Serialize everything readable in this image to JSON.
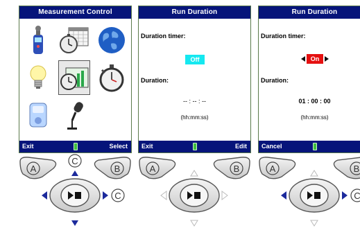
{
  "colors": {
    "title_bar": "#06147a",
    "off_toggle": "#15e8f0",
    "on_toggle": "#e51010",
    "battery": "#3fbf3f",
    "key_arrow_active": "#1c2a9c"
  },
  "panel1": {
    "title": "Measurement Control",
    "icons": [
      "sound-level-meter-icon",
      "calendar-timer-icon",
      "globe-icon",
      "light-bulb-icon",
      "run-duration-icon",
      "stopwatch-icon",
      "calibrator-icon",
      "microphone-icon"
    ],
    "selected_icon": "run-duration-icon",
    "softkeys": {
      "left": "Exit",
      "right": "Select"
    },
    "keypad": {
      "a": "A",
      "b": "B",
      "c_top": "C",
      "c_right": "C"
    }
  },
  "panel2": {
    "title": "Run Duration",
    "timer_label": "Duration timer:",
    "timer_value": "Off",
    "duration_label": "Duration:",
    "duration_value": "-- : -- : --",
    "duration_format": "(hh:mm:ss)",
    "softkeys": {
      "left": "Exit",
      "right": "Edit"
    },
    "keypad": {
      "a": "A",
      "b": "B"
    }
  },
  "panel3": {
    "title": "Run Duration",
    "timer_label": "Duration timer:",
    "timer_value": "On",
    "duration_label": "Duration:",
    "duration_value": "01 : 00 : 00",
    "duration_format": "(hh:mm:ss)",
    "softkeys": {
      "left": "Cancel",
      "right": "Sa"
    },
    "keypad": {
      "a": "A",
      "b": "B",
      "c_right": "C"
    }
  }
}
